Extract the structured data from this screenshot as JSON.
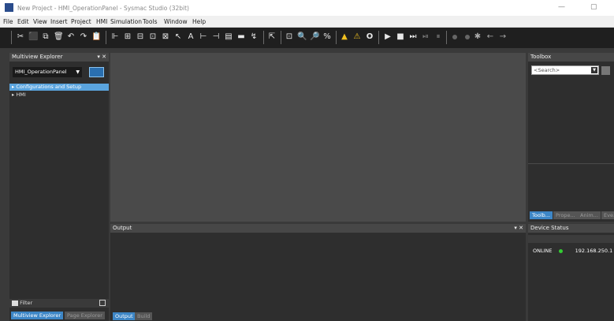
{
  "window": {
    "title": "New Project - HMI_OperationPanel - Sysmac Studio (32bit)",
    "minimize": "—",
    "maximize": "▢"
  },
  "menu": [
    "File",
    "Edit",
    "View",
    "Insert",
    "Project",
    "HMI",
    "Simulation",
    "Tools",
    "Window",
    "Help"
  ],
  "toolbar": {
    "cut": "✂",
    "save": "⬛",
    "copy": "⧉",
    "delete": "🗑",
    "undo": "↶",
    "redo": "↷",
    "paste": "📋",
    "align1": "⊩",
    "align2": "⊞",
    "align3": "⊟",
    "align4": "⊡",
    "align5": "⊠",
    "pointer": "↖",
    "bold": "A",
    "c1": "⊢",
    "c2": "⊣",
    "c3": "▤",
    "c4": "▬",
    "c5": "↯",
    "find": "⇱",
    "zoom_fit": "⊡",
    "zoom_in": "🔍",
    "zoom_out": "🔎",
    "zoom_100": "%",
    "warn1": "▲",
    "warn2": "⚠",
    "build": "O",
    "run": "▶",
    "stop": "■",
    "step": "⏭",
    "step2": "⏯",
    "step3": "⏸",
    "bp": "✱",
    "back": "←",
    "fwd": "→"
  },
  "multiview_explorer": {
    "title": "Multiview Explorer",
    "pin": "▾ ✕",
    "device_selector": "HMI_OperationPanel",
    "tree": [
      {
        "label": "Configurations and Setup",
        "selected": true
      },
      {
        "label": "HMI",
        "selected": false
      }
    ],
    "filter_label": "Filter",
    "tabs": [
      "Multiview Explorer",
      "Page Explorer"
    ]
  },
  "output": {
    "title": "Output",
    "controls": "▾ ✕",
    "tabs": [
      "Output",
      "Build"
    ]
  },
  "toolbox": {
    "title": "Toolbox",
    "search_placeholder": "<Search>",
    "tabs": [
      "Toolb...",
      "Prope...",
      "Anim...",
      "Eve..."
    ]
  },
  "device_status": {
    "title": "Device Status",
    "status": "ONLINE",
    "status_color": "#33cc33",
    "ip": "192.168.250.1"
  },
  "colors": {
    "accent": "#3d86c6",
    "warning": "#f0c020",
    "status_online": "#33cc33"
  }
}
